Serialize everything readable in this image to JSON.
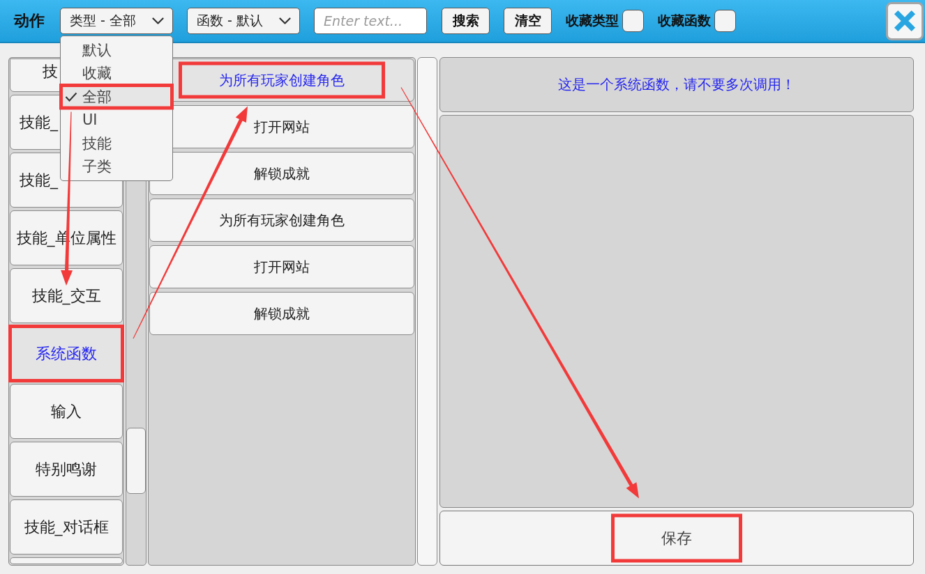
{
  "toolbar": {
    "title": "动作",
    "type_filter": {
      "value": "类型 - 全部",
      "expanded": true,
      "options": [
        {
          "label": "默认",
          "selected": false,
          "highlighted": false
        },
        {
          "label": "收藏",
          "selected": false,
          "highlighted": false
        },
        {
          "label": "全部",
          "selected": true,
          "highlighted": true
        },
        {
          "label": "UI",
          "selected": false,
          "highlighted": false
        },
        {
          "label": "技能",
          "selected": false,
          "highlighted": false
        },
        {
          "label": "子类",
          "selected": false,
          "highlighted": false
        }
      ]
    },
    "function_filter": {
      "value": "函数 - 默认",
      "expanded": false
    },
    "search": {
      "placeholder": "Enter text..."
    },
    "buttons": [
      {
        "label": "搜索"
      },
      {
        "label": "清空"
      }
    ],
    "toggles": [
      {
        "label": "收藏类型",
        "checked": false
      },
      {
        "label": "收藏函数",
        "checked": false
      }
    ]
  },
  "categories": [
    {
      "label": "技",
      "selected": false,
      "highlighted": false
    },
    {
      "label": "技能_",
      "selected": false,
      "highlighted": false
    },
    {
      "label": "技能_",
      "selected": false,
      "highlighted": false
    },
    {
      "label": "技能_单位属性",
      "selected": false,
      "highlighted": false
    },
    {
      "label": "技能_交互",
      "selected": false,
      "highlighted": false
    },
    {
      "label": "系统函数",
      "selected": true,
      "highlighted": true
    },
    {
      "label": "输入",
      "selected": false,
      "highlighted": false
    },
    {
      "label": "特别鸣谢",
      "selected": false,
      "highlighted": false
    },
    {
      "label": "技能_对话框",
      "selected": false,
      "highlighted": false
    },
    {
      "selected": false,
      "highlighted": false
    }
  ],
  "functions": [
    {
      "label": "为所有玩家创建角色",
      "selected": true,
      "highlighted": true
    },
    {
      "label": "打开网站",
      "selected": false,
      "highlighted": false
    },
    {
      "label": "解锁成就",
      "selected": false,
      "highlighted": false
    },
    {
      "label": "为所有玩家创建角色",
      "selected": false,
      "highlighted": false
    },
    {
      "label": "打开网站",
      "selected": false,
      "highlighted": false
    },
    {
      "label": "解锁成就",
      "selected": false,
      "highlighted": false
    }
  ],
  "detail": {
    "description": "这是一个系统函数，请不要多次调用！",
    "save": {
      "label": "保存",
      "highlighted": true
    }
  },
  "annotation_arrows": true
}
